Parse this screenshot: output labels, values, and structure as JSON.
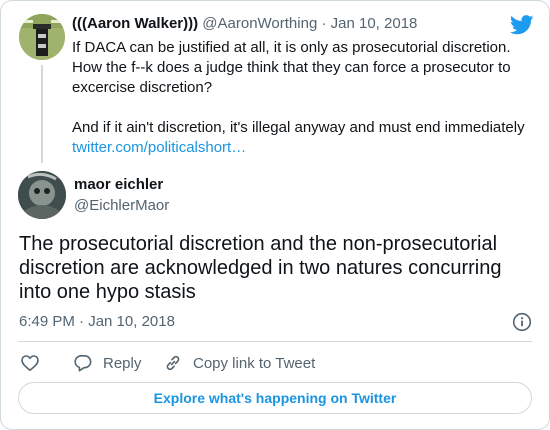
{
  "parent_tweet": {
    "display_name": "(((Aaron Walker)))",
    "handle": "@AaronWorthing",
    "separator": " · ",
    "date": "Jan 10, 2018",
    "text": "If DACA can be justified at all, it is only as prosecutorial discretion. How the f--k does a judge think that they can force a prosecutor to excercise discretion?\n\nAnd if it ain't discretion, it's illegal anyway and must end immediately",
    "link": "twitter.com/politicalshort…"
  },
  "main_tweet": {
    "display_name": "maor eichler",
    "handle": "@EichlerMaor",
    "text": "The prosecutorial discretion and the non-prosecutorial discretion are acknowledged in two natures concurring into one hypo stasis",
    "timestamp": "6:49 PM · Jan 10, 2018"
  },
  "actions": {
    "reply_label": "Reply",
    "copy_label": "Copy link to Tweet"
  },
  "explore": {
    "label": "Explore what's happening on Twitter"
  },
  "icons": {
    "brand": "twitter-bird-icon",
    "like": "heart-icon",
    "reply": "reply-bubble-icon",
    "copy": "link-icon",
    "info": "info-icon"
  },
  "colors": {
    "link": "#1b95e0",
    "text": "#0f1419",
    "muted": "#536471",
    "border": "#cfd9de",
    "brand": "#1d9bf0"
  }
}
